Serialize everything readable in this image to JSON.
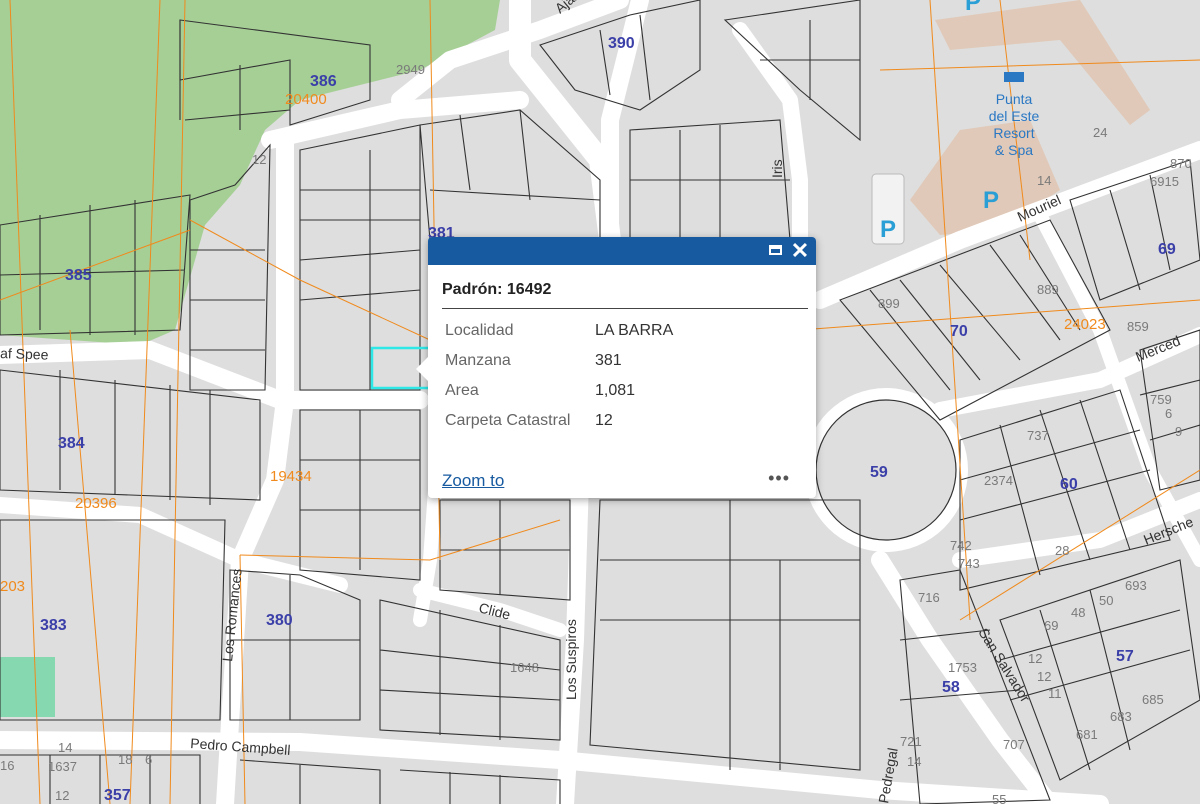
{
  "map": {
    "streets": [
      "Ajax",
      "Iris",
      "Mouriel",
      "Merced",
      "Hersche",
      "San Salvador",
      "Clide",
      "Los Suspiros",
      "Los Romances",
      "Pedro Campbell",
      "af Spee",
      "Pedregal"
    ],
    "blocks": [
      "390",
      "386",
      "385",
      "381",
      "384",
      "383",
      "380",
      "357",
      "70",
      "69",
      "59",
      "60",
      "58",
      "57"
    ],
    "parcel_numbers": [
      "2949",
      "12",
      "24",
      "14",
      "870",
      "6915",
      "899",
      "889",
      "859",
      "759",
      "6",
      "9",
      "737",
      "2374",
      "742",
      "743",
      "28",
      "716",
      "693",
      "50",
      "48",
      "69",
      "1753",
      "12",
      "12",
      "11",
      "685",
      "683",
      "681",
      "707",
      "721",
      "14",
      "1648",
      "14",
      "16",
      "1637",
      "18",
      "6",
      "12",
      "55",
      "24"
    ],
    "cadastral_numbers": [
      "20400",
      "24023",
      "19434",
      "20396",
      "203"
    ],
    "poi": {
      "name": "Punta\ndel Este\nResort\n& Spa",
      "parking": "P"
    },
    "colors": {
      "park": "#a6cf96",
      "roads": "#ffffff",
      "blocks": "#dedede",
      "cadastral_lines": "#f08a1c",
      "selection": "#2ee8e8",
      "sports_field": "#86d8b0"
    }
  },
  "popup": {
    "title": "Padrón: 16492",
    "fields": [
      {
        "label": "Localidad",
        "value": "LA BARRA"
      },
      {
        "label": "Manzana",
        "value": "381"
      },
      {
        "label": "Area",
        "value": "1,081"
      },
      {
        "label": "Carpeta Catastral",
        "value": "12"
      }
    ],
    "zoom_to": "Zoom to",
    "more": "•••",
    "close": "✕",
    "header_color": "#175aa0"
  }
}
